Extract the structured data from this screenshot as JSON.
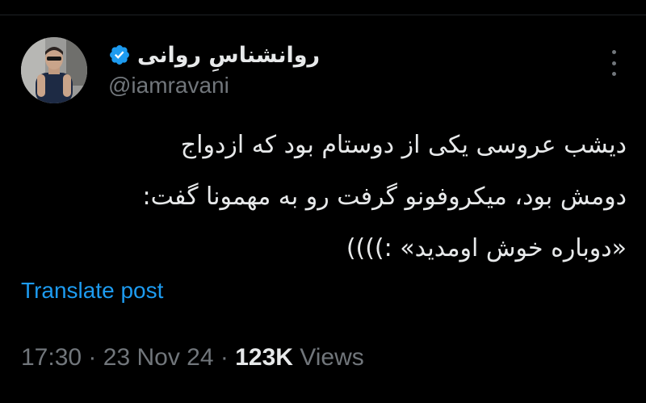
{
  "tweet": {
    "author": {
      "display_name": "روانشناسِ روانی",
      "handle": "@iamravani",
      "verified_icon": "verified-badge-icon",
      "avatar": "profile-photo"
    },
    "more_icon": "more-options-icon",
    "text_lines": [
      "دیشب عروسی یکی از دوستام بود که ازدواج",
      "دومش بود، میکروفونو گرفت رو به مهمونا گفت:",
      "«دوباره خوش اومدید» :))))"
    ],
    "translate_label": "Translate post",
    "time": "17:30",
    "separator": "·",
    "date": "23 Nov 24",
    "views_count": "123K",
    "views_label": "Views"
  },
  "colors": {
    "background": "#000000",
    "text_primary": "#e7e9ea",
    "text_secondary": "#71767b",
    "accent_link": "#1d9bf0",
    "verified_badge": "#1d9bf0"
  }
}
